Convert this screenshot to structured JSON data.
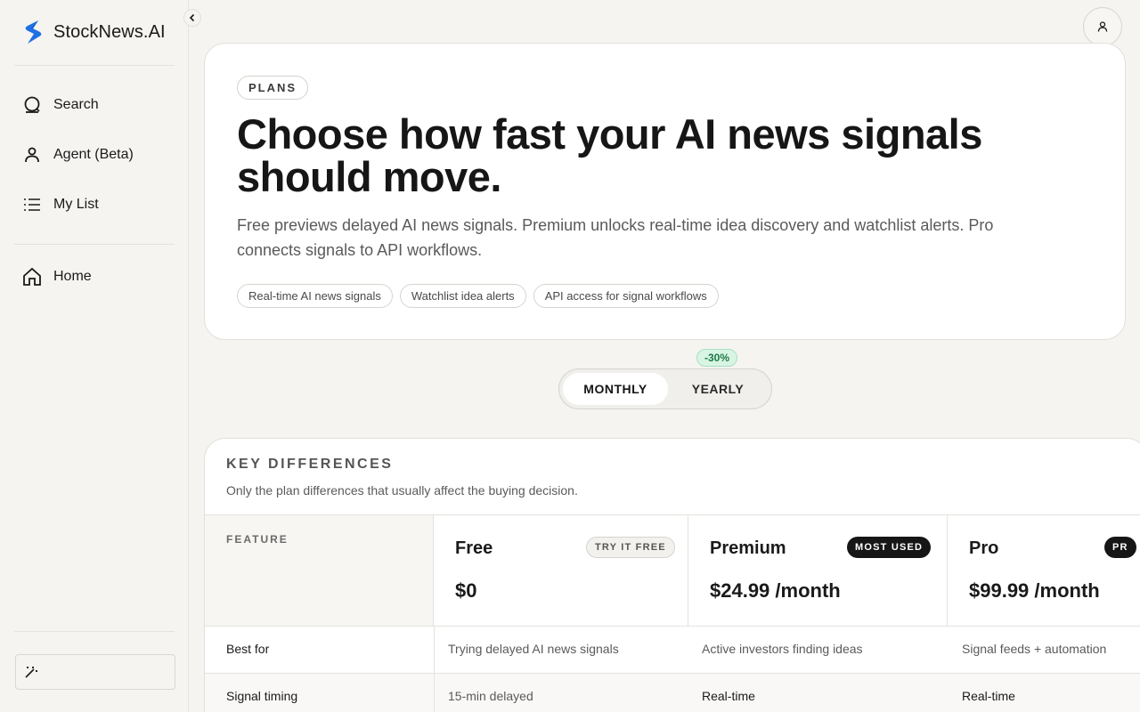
{
  "brand": {
    "name": "StockNews.AI"
  },
  "sidebar": {
    "items": [
      {
        "label": "Search",
        "icon": "search-icon"
      },
      {
        "label": "Agent (Beta)",
        "icon": "user-icon"
      },
      {
        "label": "My List",
        "icon": "list-icon"
      },
      {
        "label": "Home",
        "icon": "home-icon"
      }
    ]
  },
  "hero": {
    "pill": "PLANS",
    "title": "Choose how fast your AI news signals should move.",
    "subtitle": "Free previews delayed AI news signals. Premium unlocks real-time idea discovery and watchlist alerts. Pro connects signals to API workflows.",
    "tags": [
      "Real-time AI news signals",
      "Watchlist idea alerts",
      "API access for signal workflows"
    ]
  },
  "billing": {
    "discount": "-30%",
    "monthly": "MONTHLY",
    "yearly": "YEARLY",
    "selected": "MONTHLY"
  },
  "comparison": {
    "title": "KEY DIFFERENCES",
    "subtitle": "Only the plan differences that usually affect the buying decision.",
    "feature_header": "FEATURE",
    "plans": [
      {
        "name": "Free",
        "price": "$0",
        "badge": "TRY IT FREE"
      },
      {
        "name": "Premium",
        "price": "$24.99 /month",
        "badge": "MOST USED"
      },
      {
        "name": "Pro",
        "price": "$99.99 /month",
        "badge": "PR"
      }
    ],
    "rows": [
      {
        "feature": "Best for",
        "values": [
          "Trying delayed AI news signals",
          "Active investors finding ideas",
          "Signal feeds + automation"
        ]
      },
      {
        "feature": "Signal timing",
        "values": [
          "15-min delayed",
          "Real-time",
          "Real-time"
        ]
      }
    ]
  },
  "colors": {
    "accent": "#1f6fe5",
    "discount_bg": "#d8f5e4",
    "discount_text": "#1f7a46"
  }
}
